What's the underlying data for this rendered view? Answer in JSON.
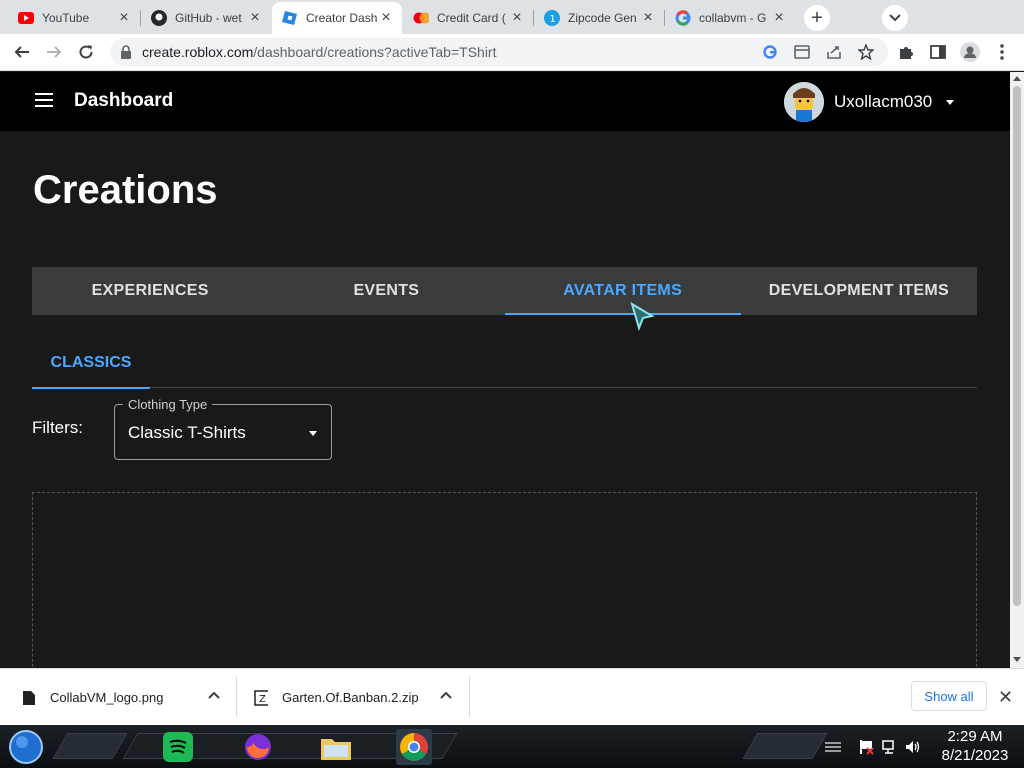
{
  "browser": {
    "tabs": [
      {
        "title": "YouTube",
        "icon": "youtube-icon",
        "active": false
      },
      {
        "title": "GitHub - wet",
        "icon": "github-icon",
        "active": false
      },
      {
        "title": "Creator Dash",
        "icon": "roblox-icon",
        "active": true
      },
      {
        "title": "Credit Card (",
        "icon": "credit-card-icon",
        "active": false
      },
      {
        "title": "Zipcode Gen",
        "icon": "zipcode-icon",
        "active": false
      },
      {
        "title": "collabvm - G",
        "icon": "google-icon",
        "active": false
      }
    ],
    "url_host": "create.roblox.com",
    "url_path": "/dashboard/creations?activeTab=TShirt"
  },
  "app": {
    "title": "Dashboard",
    "username": "Uxollacm030"
  },
  "page": {
    "heading": "Creations",
    "tabs": [
      {
        "label": "EXPERIENCES",
        "selected": false
      },
      {
        "label": "EVENTS",
        "selected": false
      },
      {
        "label": "AVATAR ITEMS",
        "selected": true
      },
      {
        "label": "DEVELOPMENT ITEMS",
        "selected": false
      }
    ],
    "subtab": "CLASSICS",
    "filters_label": "Filters:",
    "clothing_type": {
      "legend": "Clothing Type",
      "value": "Classic T-Shirts"
    }
  },
  "downloads": {
    "items": [
      {
        "name": "CollabVM_logo.png"
      },
      {
        "name": "Garten.Of.Banban.2.zip"
      }
    ],
    "show_all": "Show all"
  },
  "taskbar": {
    "time": "2:29 AM",
    "date": "8/21/2023"
  },
  "colors": {
    "accent": "#4aa8ff",
    "page_bg": "#191919",
    "appbar_bg": "#000000",
    "tabs_bg": "#393b3d"
  }
}
